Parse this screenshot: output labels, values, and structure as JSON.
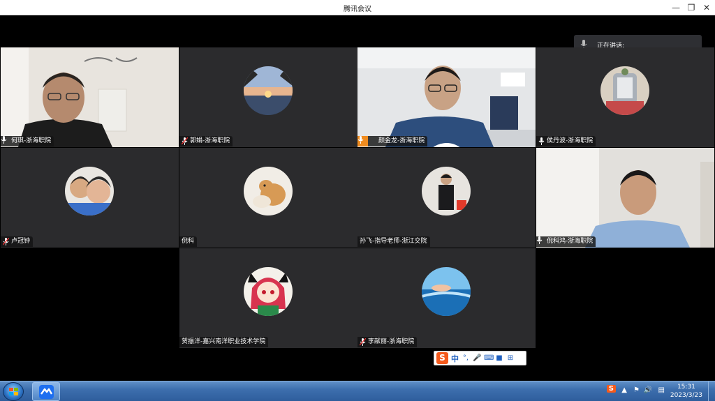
{
  "window": {
    "title": "腾讯会议"
  },
  "speaking_panel": {
    "label": "正在讲话:"
  },
  "participants": [
    {
      "name": "何琪-浙海职院"
    },
    {
      "name": "郭娟-浙海职院"
    },
    {
      "name": "颜金龙-浙海职院"
    },
    {
      "name": "侯丹波-浙海职院"
    },
    {
      "name": "卢冠钟"
    },
    {
      "name": "倪科"
    },
    {
      "name": "孙飞-指导老师-浙江交院"
    },
    {
      "name": "倪科鸿-浙海职院"
    },
    {
      "name": "贺振洋-嘉兴南洋职业技术学院"
    },
    {
      "name": "李献丽-浙海职院"
    }
  ],
  "ime": {
    "logo": "S",
    "mode": "中",
    "icons": [
      "punctuation-icon",
      "voice-icon",
      "keyboard-icon",
      "skin-icon",
      "toolbox-icon"
    ]
  },
  "taskbar": {
    "time": "15:31",
    "date": "2023/3/23"
  },
  "colors": {
    "tile_bg": "#2b2b2d",
    "host_badge": "#f08c1f",
    "taskbar": "#3d6fae"
  }
}
